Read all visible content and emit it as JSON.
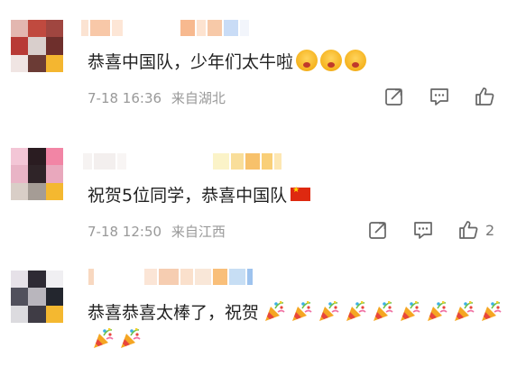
{
  "comments": [
    {
      "text": "恭喜中国队，少年们太牛啦",
      "emoji_after": [
        "flushed-face-icon",
        "flushed-face-icon",
        "flushed-face-icon"
      ],
      "time": "7-18 16:36",
      "location": "来自湖北",
      "like_count": ""
    },
    {
      "text": "祝贺5位同学，恭喜中国队",
      "emoji_after": [
        "china-flag-icon"
      ],
      "time": "7-18 12:50",
      "location": "来自江西",
      "like_count": "2"
    },
    {
      "text_line1": "恭喜恭喜太棒了，祝贺",
      "emoji_after": [
        "party-popper-icon",
        "party-popper-icon",
        "party-popper-icon",
        "party-popper-icon",
        "party-popper-icon",
        "party-popper-icon",
        "party-popper-icon",
        "party-popper-icon",
        "party-popper-icon",
        "party-popper-icon",
        "party-popper-icon"
      ]
    }
  ],
  "colors": {
    "meta": "#999999",
    "text": "#222222",
    "icon": "#666666"
  }
}
